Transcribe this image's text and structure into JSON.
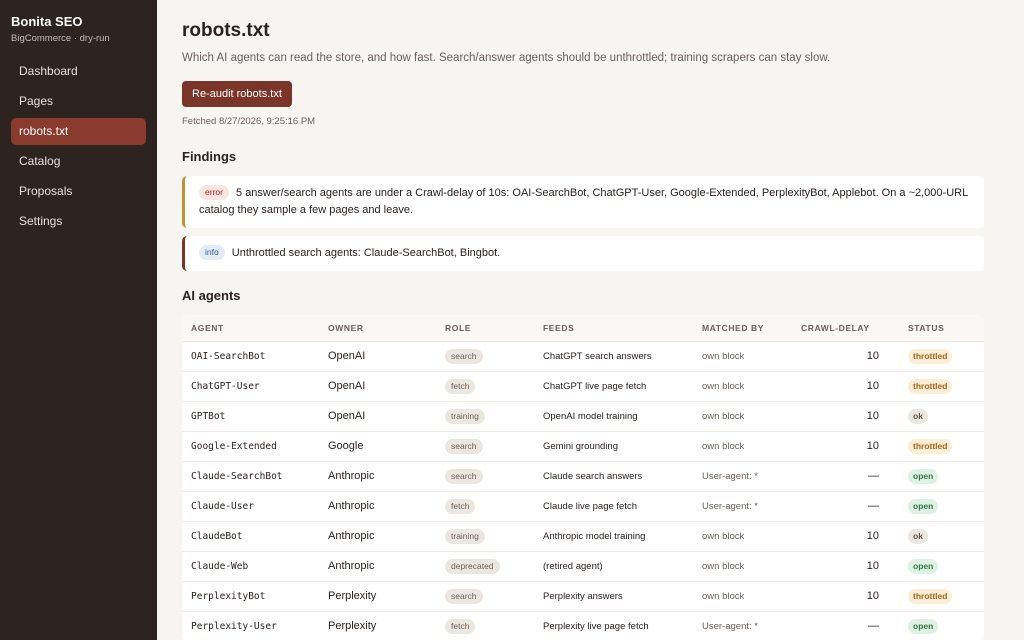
{
  "sidebar": {
    "brand": "Bonita SEO",
    "subtitle": "BigCommerce · dry-run",
    "items": [
      {
        "label": "Dashboard",
        "name": "sidebar-item-dashboard",
        "active": false
      },
      {
        "label": "Pages",
        "name": "sidebar-item-pages",
        "active": false
      },
      {
        "label": "robots.txt",
        "name": "sidebar-item-robots-txt",
        "active": true
      },
      {
        "label": "Catalog",
        "name": "sidebar-item-catalog",
        "active": false
      },
      {
        "label": "Proposals",
        "name": "sidebar-item-proposals",
        "active": false
      },
      {
        "label": "Settings",
        "name": "sidebar-item-settings",
        "active": false
      }
    ]
  },
  "header": {
    "title": "robots.txt",
    "description": "Which AI agents can read the store, and how fast. Search/answer agents should be unthrottled; training scrapers can stay slow.",
    "reaudit_label": "Re-audit robots.txt",
    "fetched": "Fetched 8/27/2026, 9:25:16 PM"
  },
  "findings": {
    "title": "Findings",
    "items": [
      {
        "level": "error",
        "text": "5 answer/search agents are under a Crawl-delay of 10s: OAI-SearchBot, ChatGPT-User, Google-Extended, PerplexityBot, Applebot. On a ~2,000-URL catalog they sample a few pages and leave."
      },
      {
        "level": "info",
        "text": "Unthrottled search agents: Claude-SearchBot, Bingbot."
      }
    ]
  },
  "agents": {
    "title": "AI agents",
    "columns": {
      "agent": "Agent",
      "owner": "Owner",
      "role": "Role",
      "feeds": "Feeds",
      "matched": "Matched by",
      "delay": "Crawl-delay",
      "status": "Status"
    },
    "rows": [
      {
        "agent": "OAI-SearchBot",
        "owner": "OpenAI",
        "role": "search",
        "feeds": "ChatGPT search answers",
        "matched": "own block",
        "delay": "10",
        "status": "throttled"
      },
      {
        "agent": "ChatGPT-User",
        "owner": "OpenAI",
        "role": "fetch",
        "feeds": "ChatGPT live page fetch",
        "matched": "own block",
        "delay": "10",
        "status": "throttled"
      },
      {
        "agent": "GPTBot",
        "owner": "OpenAI",
        "role": "training",
        "feeds": "OpenAI model training",
        "matched": "own block",
        "delay": "10",
        "status": "ok"
      },
      {
        "agent": "Google-Extended",
        "owner": "Google",
        "role": "search",
        "feeds": "Gemini grounding",
        "matched": "own block",
        "delay": "10",
        "status": "throttled"
      },
      {
        "agent": "Claude-SearchBot",
        "owner": "Anthropic",
        "role": "search",
        "feeds": "Claude search answers",
        "matched": "User-agent: *",
        "delay": "—",
        "status": "open"
      },
      {
        "agent": "Claude-User",
        "owner": "Anthropic",
        "role": "fetch",
        "feeds": "Claude live page fetch",
        "matched": "User-agent: *",
        "delay": "—",
        "status": "open"
      },
      {
        "agent": "ClaudeBot",
        "owner": "Anthropic",
        "role": "training",
        "feeds": "Anthropic model training",
        "matched": "own block",
        "delay": "10",
        "status": "ok"
      },
      {
        "agent": "Claude-Web",
        "owner": "Anthropic",
        "role": "deprecated",
        "feeds": "(retired agent)",
        "matched": "own block",
        "delay": "10",
        "status": "open"
      },
      {
        "agent": "PerplexityBot",
        "owner": "Perplexity",
        "role": "search",
        "feeds": "Perplexity answers",
        "matched": "own block",
        "delay": "10",
        "status": "throttled"
      },
      {
        "agent": "Perplexity-User",
        "owner": "Perplexity",
        "role": "fetch",
        "feeds": "Perplexity live page fetch",
        "matched": "User-agent: *",
        "delay": "—",
        "status": "open"
      }
    ]
  },
  "colors": {
    "sidebar_bg": "#2d2320",
    "accent": "#7a3428",
    "active_nav": "#8a3b2d",
    "throttled": "#a8661a",
    "open": "#2f7a45"
  }
}
